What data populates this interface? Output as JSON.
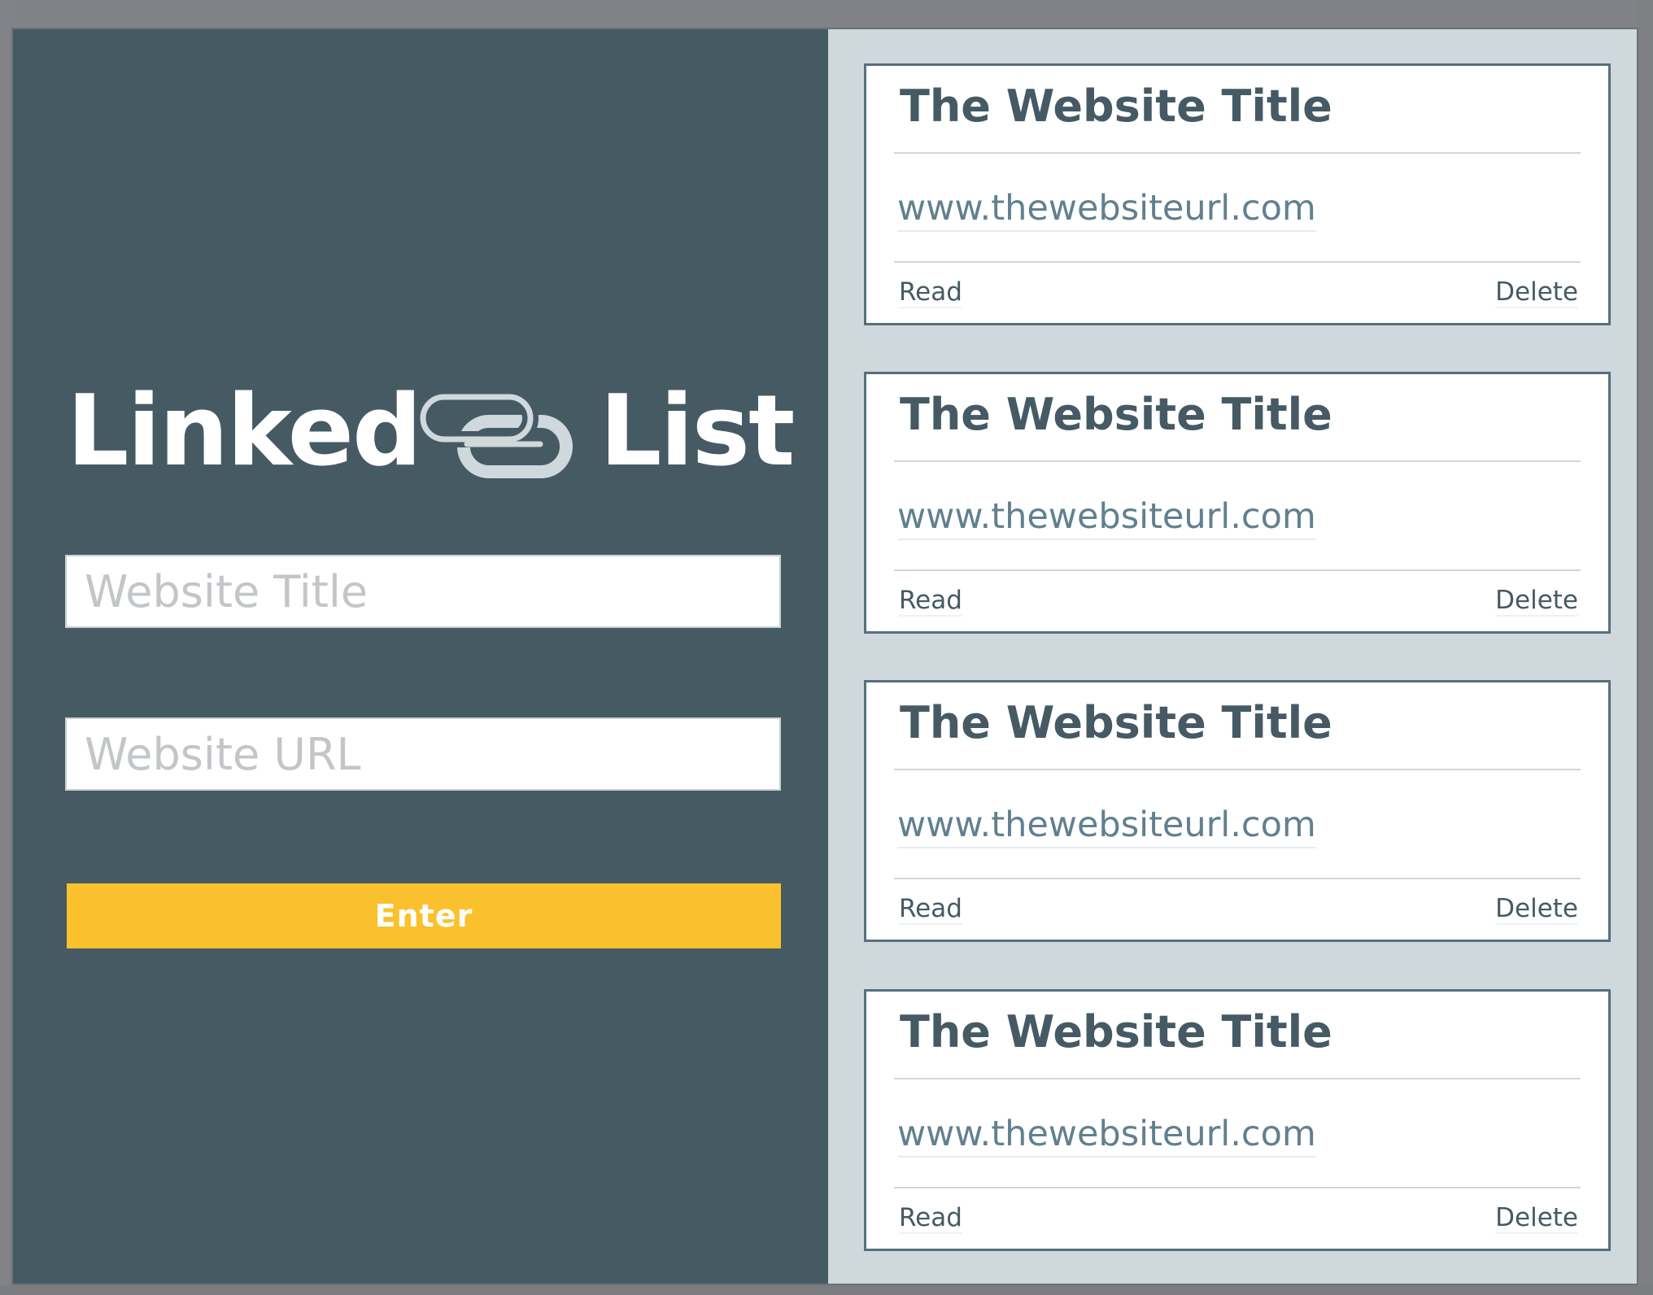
{
  "app": {
    "logo_word_1": "Linked",
    "logo_word_2": "List",
    "logo_icon": "link-chain-icon"
  },
  "form": {
    "title_placeholder": "Website Title",
    "url_placeholder": "Website URL",
    "enter_label": "Enter"
  },
  "bookmarks": [
    {
      "title": "The Website Title",
      "url": "www.thewebsiteurl.com",
      "read_label": "Read",
      "delete_label": "Delete"
    },
    {
      "title": "The Website Title",
      "url": "www.thewebsiteurl.com",
      "read_label": "Read",
      "delete_label": "Delete"
    },
    {
      "title": "The Website Title",
      "url": "www.thewebsiteurl.com",
      "read_label": "Read",
      "delete_label": "Delete"
    },
    {
      "title": "The Website Title",
      "url": "www.thewebsiteurl.com",
      "read_label": "Read",
      "delete_label": "Delete"
    }
  ],
  "colors": {
    "left_panel": "#465a64",
    "right_panel": "#cfd8dd",
    "accent": "#fbc02d",
    "card_border": "#55707e",
    "title_text": "#455a64",
    "url_text": "#61808f"
  }
}
